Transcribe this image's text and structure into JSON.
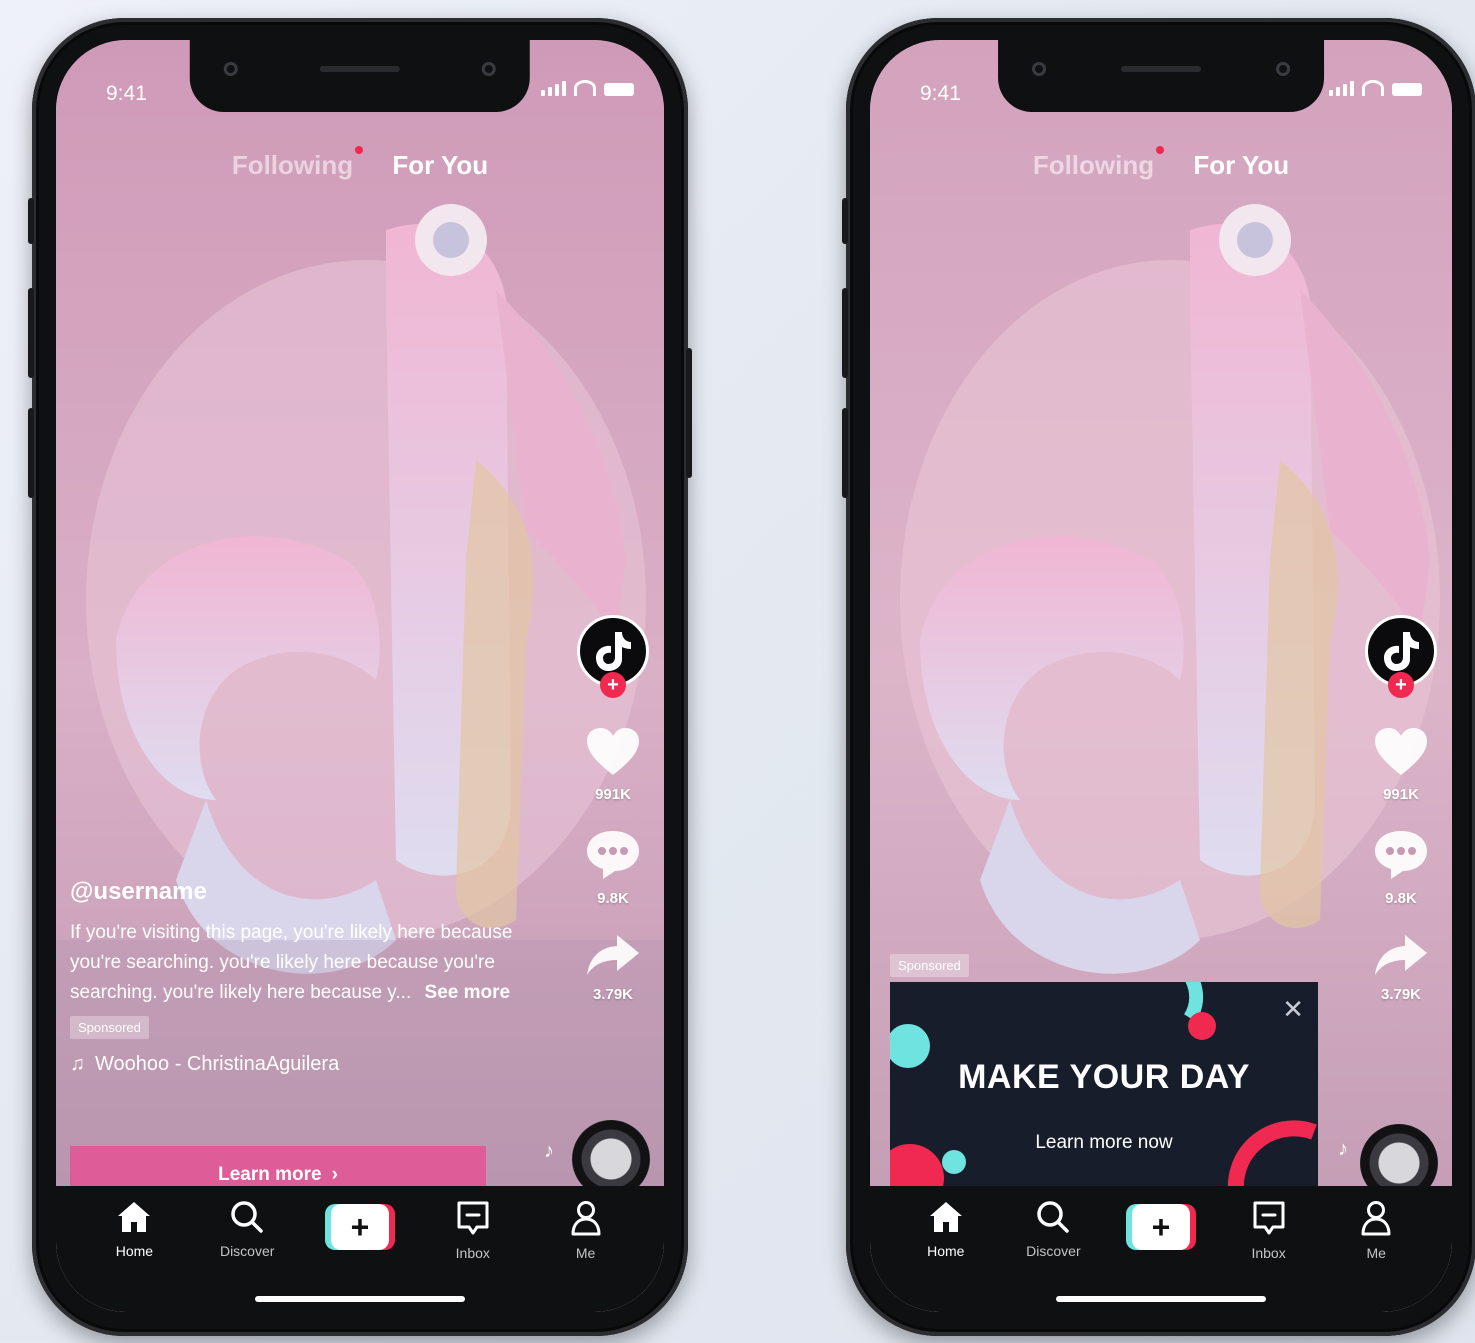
{
  "phones": {
    "left": {
      "status_time": "9:41",
      "top_nav": {
        "following": "Following",
        "for_you": "For You"
      },
      "rail": {
        "likes": "991K",
        "comments": "9.8K",
        "shares": "3.79K"
      },
      "post": {
        "username": "@username",
        "caption": "If you're visiting this page, you're likely here because you're searching. you're likely here because you're searching. you're likely here because y...",
        "see_more": "See more",
        "sponsored": "Sponsored",
        "music": "Woohoo - ChristinaAguilera",
        "cta": "Learn more"
      },
      "bottom_nav": {
        "home": "Home",
        "discover": "Discover",
        "inbox": "Inbox",
        "me": "Me"
      }
    },
    "right": {
      "status_time": "9:41",
      "top_nav": {
        "following": "Following",
        "for_you": "For You"
      },
      "rail": {
        "likes": "991K",
        "comments": "9.8K",
        "shares": "3.79K"
      },
      "ad": {
        "sponsored": "Sponsored",
        "title": "MAKE YOUR DAY",
        "subtitle": "Learn more now"
      },
      "bottom_nav": {
        "home": "Home",
        "discover": "Discover",
        "inbox": "Inbox",
        "me": "Me"
      }
    }
  },
  "icons": {
    "avatar": "tiktok-logo-icon",
    "like": "heart-icon",
    "comment": "comment-bubble-icon",
    "share": "share-arrow-icon",
    "music": "music-note-icon",
    "home": "home-icon",
    "discover": "search-icon",
    "create": "plus-icon",
    "inbox": "inbox-icon",
    "me": "person-icon",
    "close": "close-icon"
  },
  "colors": {
    "brand_pink": "#ef2950",
    "brand_cyan": "#6fe3e0",
    "cta_pink": "#de5c98",
    "ad_background": "#171d2a",
    "nav_background": "#0f1012"
  }
}
